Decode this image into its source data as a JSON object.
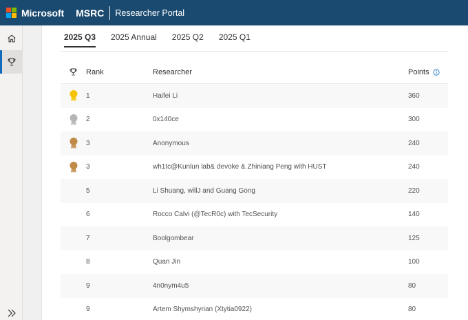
{
  "header": {
    "brand": "Microsoft",
    "product": "MSRC",
    "portal": "Researcher Portal",
    "logo_colors": [
      "#f25022",
      "#7fba00",
      "#00a4ef",
      "#ffb900"
    ]
  },
  "nav": {
    "items": [
      {
        "icon": "home-icon"
      },
      {
        "icon": "trophy-icon",
        "active": true
      }
    ],
    "expand_icon": "double-chevron-right-icon"
  },
  "tabs": [
    {
      "label": "2025 Q3",
      "active": true
    },
    {
      "label": "2025 Annual"
    },
    {
      "label": "2025 Q2"
    },
    {
      "label": "2025 Q1"
    }
  ],
  "table": {
    "columns": {
      "medal_icon": "trophy-icon",
      "rank": "Rank",
      "researcher": "Researcher",
      "points": "Points",
      "points_info_icon": "info-icon"
    },
    "medal_colors": {
      "gold": "#f5c400",
      "silver": "#b5b5b5",
      "bronze": "#c08a48"
    },
    "rows": [
      {
        "medal": "gold",
        "rank": "1",
        "researcher": "Haifei Li",
        "points": "360"
      },
      {
        "medal": "silver",
        "rank": "2",
        "researcher": "0x140ce",
        "points": "300"
      },
      {
        "medal": "bronze",
        "rank": "3",
        "researcher": "Anonymous",
        "points": "240"
      },
      {
        "medal": "bronze",
        "rank": "3",
        "researcher": "wh1tc@Kunlun lab& devoke & Zhiniang Peng with HUST",
        "points": "240"
      },
      {
        "medal": "",
        "rank": "5",
        "researcher": "Li Shuang, willJ and Guang Gong",
        "points": "220"
      },
      {
        "medal": "",
        "rank": "6",
        "researcher": "Rocco Calvi (@TecR0c) with TecSecurity",
        "points": "140"
      },
      {
        "medal": "",
        "rank": "7",
        "researcher": "Boolgombear",
        "points": "125"
      },
      {
        "medal": "",
        "rank": "8",
        "researcher": "Quan Jin",
        "points": "100"
      },
      {
        "medal": "",
        "rank": "9",
        "researcher": "4n0nym4u5",
        "points": "80"
      },
      {
        "medal": "",
        "rank": "9",
        "researcher": "Artem Shymshyrian (Xtytia0922)",
        "points": "80"
      }
    ]
  }
}
